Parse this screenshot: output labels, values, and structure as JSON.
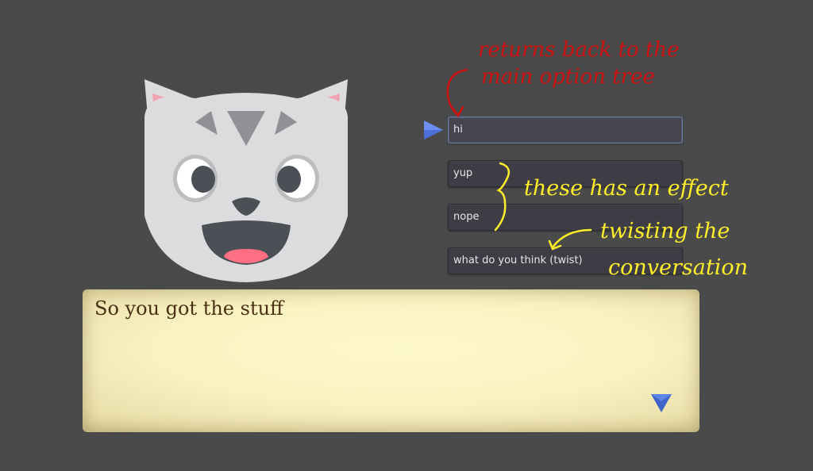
{
  "character": {
    "name_icon": "cat-face"
  },
  "options": [
    {
      "label": "hi"
    },
    {
      "label": "yup"
    },
    {
      "label": "nope"
    },
    {
      "label": "what do you think (twist)"
    }
  ],
  "dialogue": {
    "text": "So you got the stuff"
  },
  "annotations": {
    "red_line1": "returns back to the",
    "red_line2": "main option tree",
    "effect": "these has an effect",
    "twist_line1": "twisting the",
    "twist_line2": "conversation"
  },
  "colors": {
    "background": "#4a4a4a",
    "option_bg": "#3e3c45",
    "selected_border": "#6b7fa8",
    "cursor": "#4a6fd6",
    "dialogue_bg": "#fbf4c6",
    "dialogue_text": "#4a2f14",
    "annotation_red": "#cf1212",
    "annotation_yellow": "#ffee2a"
  }
}
